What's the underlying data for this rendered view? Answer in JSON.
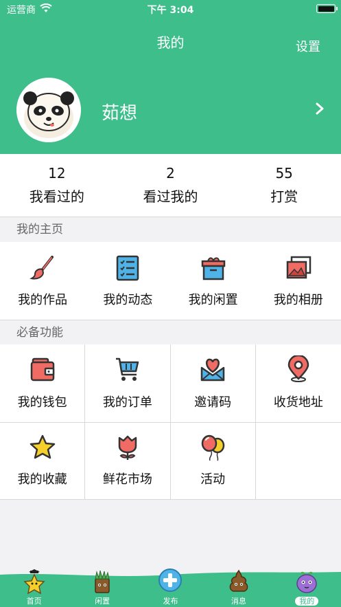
{
  "status_bar": {
    "carrier": "运营商",
    "time": "下午 3:04"
  },
  "header": {
    "title": "我的",
    "settings_label": "设置",
    "username": "茹想"
  },
  "stats": [
    {
      "value": "12",
      "label": "我看过的"
    },
    {
      "value": "2",
      "label": "看过我的"
    },
    {
      "value": "55",
      "label": "打赏"
    }
  ],
  "homepage_section": {
    "title": "我的主页",
    "items": [
      {
        "label": "我的作品",
        "icon": "brush-icon"
      },
      {
        "label": "我的动态",
        "icon": "checklist-icon"
      },
      {
        "label": "我的闲置",
        "icon": "box-icon"
      },
      {
        "label": "我的相册",
        "icon": "photo-album-icon"
      }
    ]
  },
  "features_section": {
    "title": "必备功能",
    "items": [
      {
        "label": "我的钱包",
        "icon": "wallet-icon"
      },
      {
        "label": "我的订单",
        "icon": "cart-icon"
      },
      {
        "label": "邀请码",
        "icon": "heart-envelope-icon"
      },
      {
        "label": "收货地址",
        "icon": "location-pin-icon"
      },
      {
        "label": "我的收藏",
        "icon": "star-icon"
      },
      {
        "label": "鲜花市场",
        "icon": "tulip-icon"
      },
      {
        "label": "活动",
        "icon": "balloons-icon"
      }
    ]
  },
  "tabbar": [
    {
      "label": "首页",
      "icon": "star-mascot-icon"
    },
    {
      "label": "闲置",
      "icon": "grass-mascot-icon"
    },
    {
      "label": "发布",
      "icon": "plus-mascot-icon"
    },
    {
      "label": "消息",
      "icon": "poop-mascot-icon"
    },
    {
      "label": "我的",
      "icon": "grape-mascot-icon",
      "active": true
    }
  ],
  "colors": {
    "brand_green": "#3dbe8b",
    "icon_blue": "#4fb3e8",
    "icon_red": "#ef6b63",
    "icon_yellow": "#f6d02a"
  }
}
